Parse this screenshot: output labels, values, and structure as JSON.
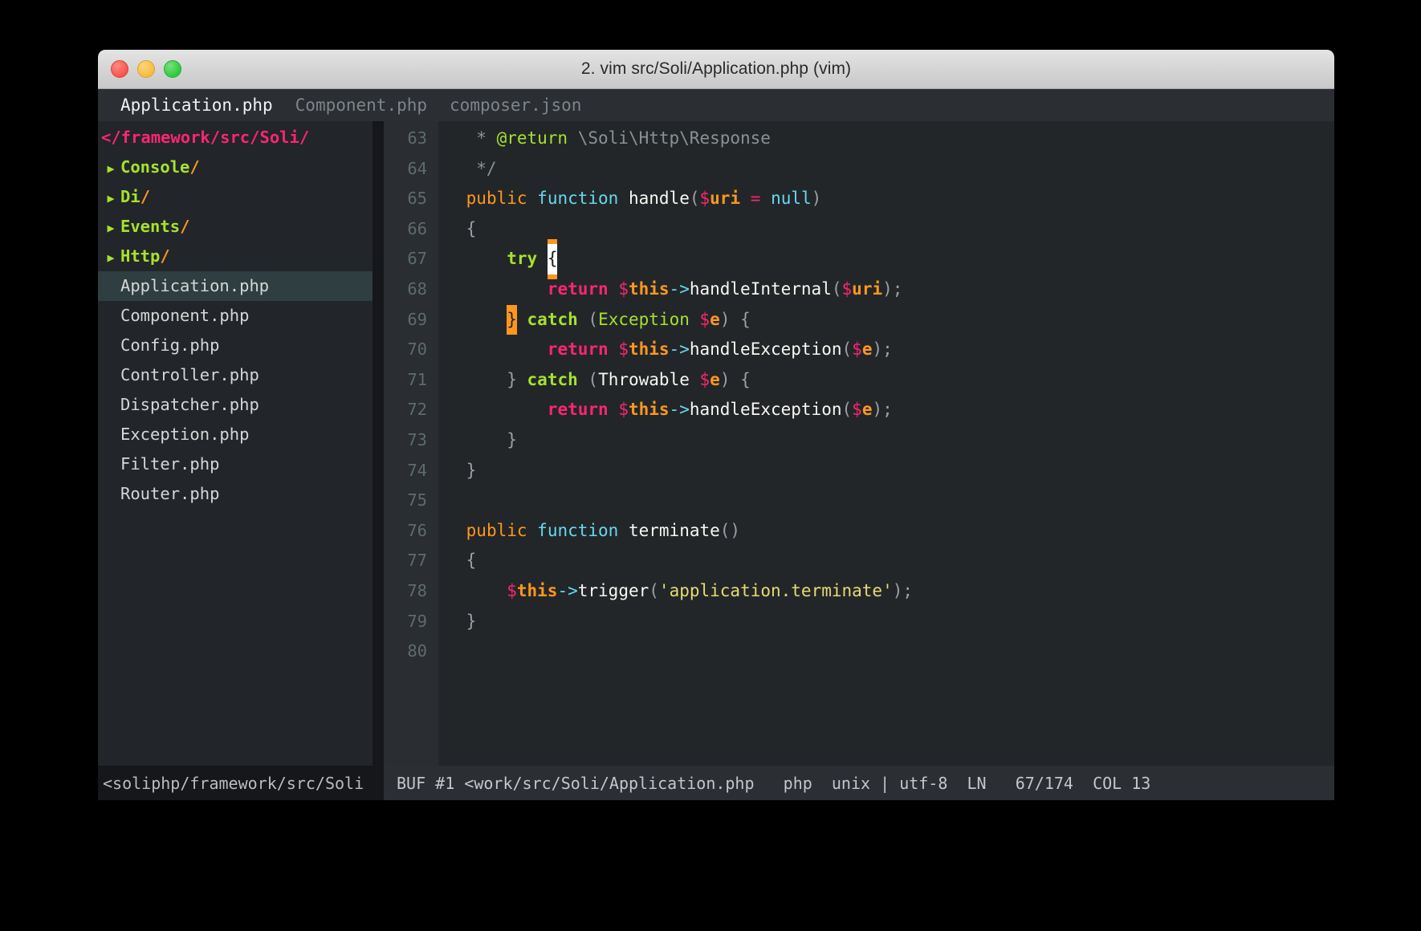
{
  "window": {
    "title": "2. vim src/Soli/Application.php (vim)",
    "traffic_lights": [
      "close-icon",
      "minimize-icon",
      "maximize-icon"
    ]
  },
  "tabline": {
    "tabs": [
      {
        "label": "Application.php",
        "active": true
      },
      {
        "label": "Component.php",
        "active": false
      },
      {
        "label": "composer.json",
        "active": false
      }
    ]
  },
  "sidebar": {
    "root_label": "</framework/src/Soli/",
    "dirs": [
      {
        "arrow": "chevron-right-icon",
        "name": "Console",
        "slash": "/"
      },
      {
        "arrow": "chevron-right-icon",
        "name": "Di",
        "slash": "/"
      },
      {
        "arrow": "chevron-right-icon",
        "name": "Events",
        "slash": "/"
      },
      {
        "arrow": "chevron-right-icon",
        "name": "Http",
        "slash": "/"
      }
    ],
    "files": [
      {
        "name": "Application.php",
        "selected": true
      },
      {
        "name": "Component.php",
        "selected": false
      },
      {
        "name": "Config.php",
        "selected": false
      },
      {
        "name": "Controller.php",
        "selected": false
      },
      {
        "name": "Dispatcher.php",
        "selected": false
      },
      {
        "name": "Exception.php",
        "selected": false
      },
      {
        "name": "Filter.php",
        "selected": false
      },
      {
        "name": "Router.php",
        "selected": false
      }
    ],
    "status": "<soliphp/framework/src/Soli"
  },
  "editor": {
    "line_numbers": [
      "63",
      "64",
      "65",
      "66",
      "67",
      "68",
      "69",
      "70",
      "71",
      "72",
      "73",
      "74",
      "75",
      "76",
      "77",
      "78",
      "79",
      "80"
    ],
    "lines": [
      "     * @return \\Soli\\Http\\Response",
      "     */",
      "    public function handle($uri = null)",
      "    {",
      "        try {",
      "            return $this->handleInternal($uri);",
      "        } catch (Exception $e) {",
      "            return $this->handleException($e);",
      "        } catch (Throwable $e) {",
      "            return $this->handleException($e);",
      "        }",
      "    }",
      "",
      "    public function terminate()",
      "    {",
      "        $this->trigger('application.terminate');",
      "    }",
      ""
    ],
    "status": {
      "buffer": "BUF #1 <work/src/Soli/Application.php",
      "filetype": "php",
      "fileformat": "unix",
      "encoding": "utf-8",
      "line_label": "LN",
      "line_position": "67/174",
      "column_label": "COL",
      "column_position": "13",
      "separator": "|"
    }
  },
  "colors": {
    "background": "#232629",
    "sidebar_bg": "#22252a",
    "titlebar": "#d6d6d6",
    "keyword_orange": "#fd971f",
    "function_cyan": "#66d9ef",
    "string_yellow": "#e6db74",
    "accent_pink": "#f92672",
    "accent_green": "#a6e22e",
    "selection": "#2f3e40"
  }
}
